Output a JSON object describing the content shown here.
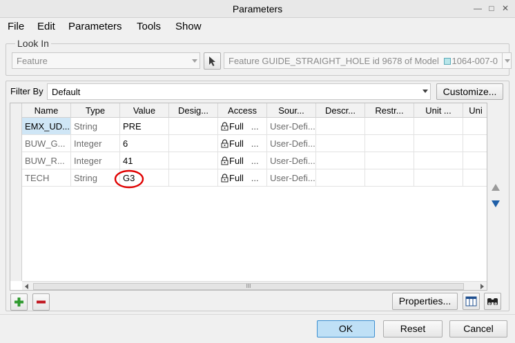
{
  "window": {
    "title": "Parameters"
  },
  "menu": [
    "File",
    "Edit",
    "Parameters",
    "Tools",
    "Show"
  ],
  "look_in": {
    "legend": "Look In",
    "type_value": "Feature",
    "feature_value": "Feature GUIDE_STRAIGHT_HOLE id 9678 of Model",
    "model_value": "1064-007-0"
  },
  "filter": {
    "label": "Filter By",
    "value": "Default",
    "customize_label": "Customize..."
  },
  "table": {
    "columns": [
      "Name",
      "Type",
      "Value",
      "Desig...",
      "Access",
      "Sour...",
      "Descr...",
      "Restr...",
      "Unit ...",
      "Uni"
    ],
    "rows": [
      {
        "name": "EMX_UD...",
        "type": "String",
        "value": "PRE",
        "access": "Full",
        "access_more": "...",
        "source": "User-Defi..."
      },
      {
        "name": "BUW_G...",
        "type": "Integer",
        "value": "6",
        "access": "Full",
        "access_more": "...",
        "source": "User-Defi..."
      },
      {
        "name": "BUW_R...",
        "type": "Integer",
        "value": "41",
        "access": "Full",
        "access_more": "...",
        "source": "User-Defi..."
      },
      {
        "name": "TECH",
        "type": "String",
        "value": "G3",
        "access": "Full",
        "access_more": "...",
        "source": "User-Defi..."
      }
    ],
    "scroll_grip": "III"
  },
  "buttons": {
    "properties": "Properties...",
    "ok": "OK",
    "reset": "Reset",
    "cancel": "Cancel"
  },
  "colors": {
    "ok_button": "#bfe0f6",
    "selection": "#cfe6f6",
    "annotation_circle": "#e00000",
    "add_icon": "#2f9a2f",
    "remove_icon": "#c0141e",
    "move_arrows": "#1f5fa8"
  }
}
